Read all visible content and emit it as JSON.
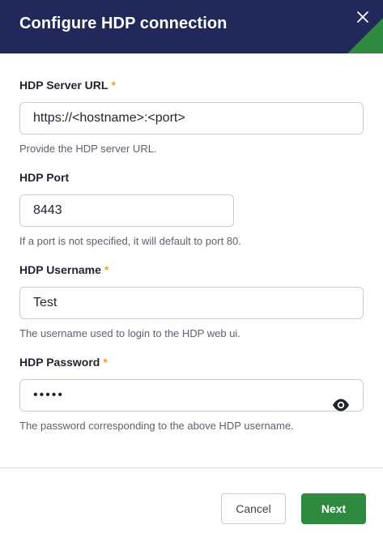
{
  "dialog": {
    "title": "Configure HDP connection",
    "close_icon": "close-icon"
  },
  "fields": {
    "server_url": {
      "label": "HDP Server URL",
      "required_mark": "*",
      "value": "https://<hostname>:<port>",
      "help": "Provide the HDP server URL."
    },
    "port": {
      "label": "HDP Port",
      "value": "8443",
      "help": "If a port is not specified, it will default to port 80."
    },
    "username": {
      "label": "HDP Username",
      "required_mark": "*",
      "value": "Test",
      "help": "The username used to login to the HDP web ui."
    },
    "password": {
      "label": "HDP Password",
      "required_mark": "*",
      "value": "•••••",
      "help": "The password corresponding to the above HDP username.",
      "toggle_icon": "eye-icon"
    }
  },
  "footer": {
    "cancel_label": "Cancel",
    "next_label": "Next"
  },
  "colors": {
    "header_bg": "#20295a",
    "accent_green": "#2e8a3f",
    "required_star": "#e8a23a"
  }
}
